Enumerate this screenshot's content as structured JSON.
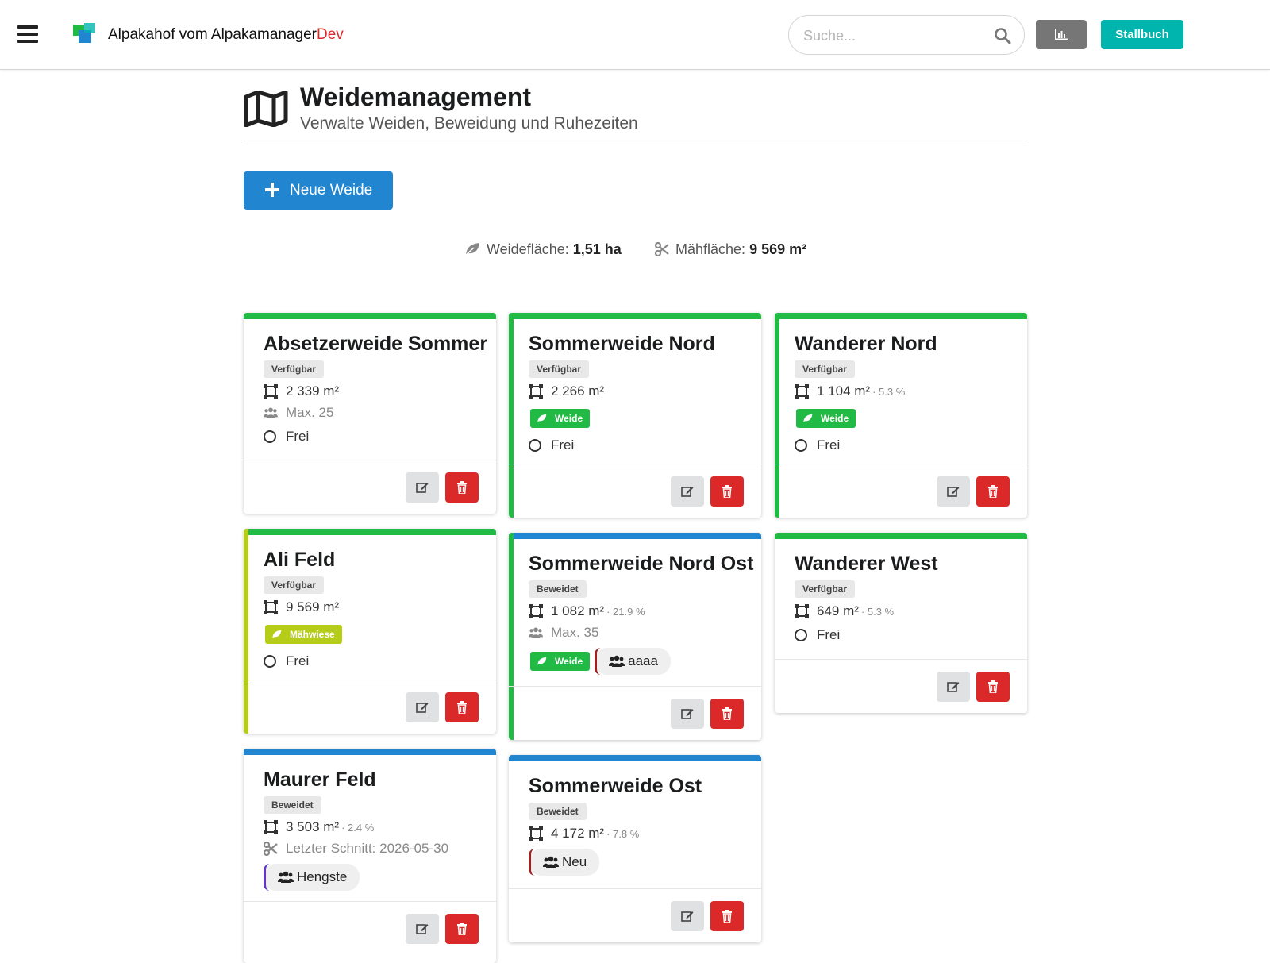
{
  "app": {
    "brand_main": "Alpakahof vom Alpakamanager",
    "brand_suffix": "Dev",
    "search_placeholder": "Suche...",
    "stallbuch_label": "Stallbuch"
  },
  "header": {
    "title": "Weidemanagement",
    "subtitle": "Verwalte Weiden, Beweidung und Ruhezeiten",
    "new_button": "Neue Weide"
  },
  "stats": {
    "weide_label": "Weidefläche:",
    "weide_value": "1,51 ha",
    "maeh_label": "Mähfläche:",
    "maeh_value": "9 569 m²"
  },
  "colors": {
    "green": "#21ba45",
    "blue": "#2185d0",
    "olive": "#b5cc18",
    "red": "#db2828",
    "teal": "#00b5ad"
  },
  "cards": [
    {
      "title": "Absetzerweide Sommer",
      "status": "Verfügbar",
      "area": "2 339 m²",
      "capacity": "Max. 25",
      "free": "Frei"
    },
    {
      "title": "Sommerweide Nord",
      "status": "Verfügbar",
      "area": "2 266 m²",
      "tag": "Weide",
      "free": "Frei"
    },
    {
      "title": "Wanderer Nord",
      "status": "Verfügbar",
      "area": "1 104 m²",
      "pct": "· 5.3 %",
      "tag": "Weide",
      "free": "Frei"
    },
    {
      "title": "Ali Feld",
      "status": "Verfügbar",
      "area": "9 569 m²",
      "tag": "Mähwiese",
      "free": "Frei"
    },
    {
      "title": "Sommerweide Nord Ost",
      "status": "Beweidet",
      "area": "1 082 m²",
      "pct": "· 21.9 %",
      "capacity": "Max. 35",
      "tag": "Weide",
      "group": "aaaa"
    },
    {
      "title": "Wanderer West",
      "status": "Verfügbar",
      "area": "649 m²",
      "pct": "· 5.3 %",
      "free": "Frei"
    },
    {
      "title": "Maurer Feld",
      "status": "Beweidet",
      "area": "3 503 m²",
      "pct": "· 2.4 %",
      "last_cut": "Letzter Schnitt: 2026-05-30",
      "group": "Hengste"
    },
    {
      "title": "Sommerweide Ost",
      "status": "Beweidet",
      "area": "4 172 m²",
      "pct": "· 7.8 %",
      "group": "Neu"
    }
  ]
}
